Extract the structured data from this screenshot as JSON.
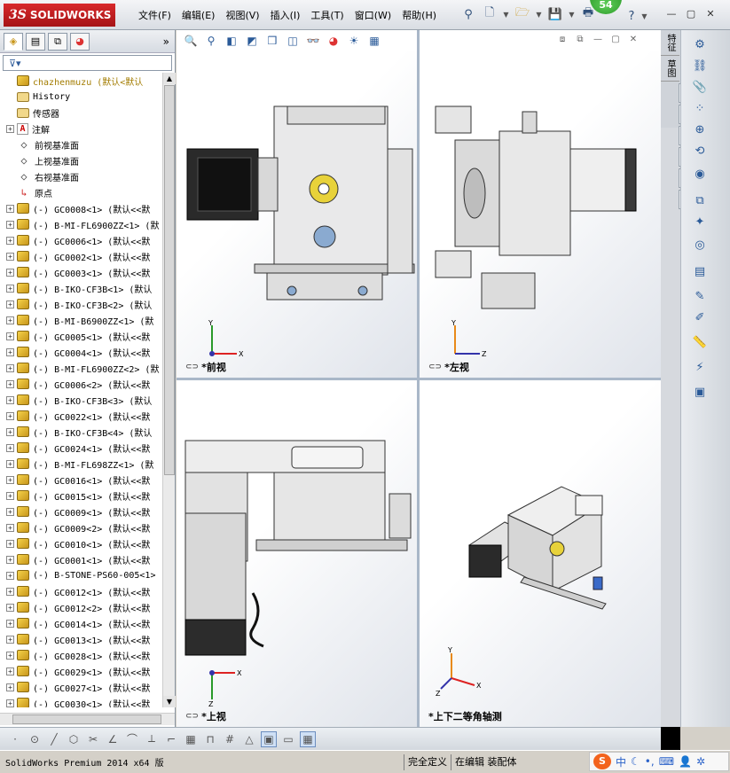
{
  "app": {
    "logo_text": "SOLIDWORKS",
    "logo_ds": "3S",
    "notification_count": "54"
  },
  "menu": [
    "文件(F)",
    "编辑(E)",
    "视图(V)",
    "插入(I)",
    "工具(T)",
    "窗口(W)",
    "帮助(H)"
  ],
  "feature_manager": {
    "filter_icon": "filter-icon",
    "root": "chazhenmuzu  (默认<默认",
    "items": [
      {
        "label": "History",
        "icon": "history",
        "expandable": false
      },
      {
        "label": "传感器",
        "icon": "sensor",
        "expandable": false
      },
      {
        "label": "注解",
        "icon": "annotation",
        "expandable": true
      },
      {
        "label": "前视基准面",
        "icon": "plane",
        "expandable": false
      },
      {
        "label": "上视基准面",
        "icon": "plane",
        "expandable": false
      },
      {
        "label": "右视基准面",
        "icon": "plane",
        "expandable": false
      },
      {
        "label": "原点",
        "icon": "origin",
        "expandable": false
      },
      {
        "label": "(-) GC0008<1> (默认<<默",
        "icon": "part",
        "expandable": true
      },
      {
        "label": "(-) B-MI-FL6900ZZ<1> (默",
        "icon": "part",
        "expandable": true
      },
      {
        "label": "(-) GC0006<1> (默认<<默",
        "icon": "part",
        "expandable": true
      },
      {
        "label": "(-) GC0002<1> (默认<<默",
        "icon": "part",
        "expandable": true
      },
      {
        "label": "(-) GC0003<1> (默认<<默",
        "icon": "part",
        "expandable": true
      },
      {
        "label": "(-) B-IKO-CF3B<1> (默认",
        "icon": "part",
        "expandable": true
      },
      {
        "label": "(-) B-IKO-CF3B<2> (默认",
        "icon": "part",
        "expandable": true
      },
      {
        "label": "(-) B-MI-B6900ZZ<1> (默",
        "icon": "part",
        "expandable": true
      },
      {
        "label": "(-) GC0005<1> (默认<<默",
        "icon": "part",
        "expandable": true
      },
      {
        "label": "(-) GC0004<1> (默认<<默",
        "icon": "part",
        "expandable": true
      },
      {
        "label": "(-) B-MI-FL6900ZZ<2> (默",
        "icon": "part",
        "expandable": true
      },
      {
        "label": "(-) GC0006<2> (默认<<默",
        "icon": "part",
        "expandable": true
      },
      {
        "label": "(-) B-IKO-CF3B<3> (默认",
        "icon": "part",
        "expandable": true
      },
      {
        "label": "(-) GC0022<1> (默认<<默",
        "icon": "part",
        "expandable": true
      },
      {
        "label": "(-) B-IKO-CF3B<4> (默认",
        "icon": "part",
        "expandable": true
      },
      {
        "label": "(-) GC0024<1> (默认<<默",
        "icon": "part",
        "expandable": true
      },
      {
        "label": "(-) B-MI-FL698ZZ<1> (默",
        "icon": "part",
        "expandable": true
      },
      {
        "label": "(-) GC0016<1> (默认<<默",
        "icon": "part",
        "expandable": true
      },
      {
        "label": "(-) GC0015<1> (默认<<默",
        "icon": "part",
        "expandable": true
      },
      {
        "label": "(-) GC0009<1> (默认<<默",
        "icon": "part",
        "expandable": true
      },
      {
        "label": "(-) GC0009<2> (默认<<默",
        "icon": "part",
        "expandable": true
      },
      {
        "label": "(-) GC0010<1> (默认<<默",
        "icon": "part",
        "expandable": true
      },
      {
        "label": "(-) GC0001<1> (默认<<默",
        "icon": "part",
        "expandable": true
      },
      {
        "label": "(-) B-STONE-PS60-005<1>",
        "icon": "part",
        "expandable": true
      },
      {
        "label": "(-) GC0012<1> (默认<<默",
        "icon": "part",
        "expandable": true
      },
      {
        "label": "(-) GC0012<2> (默认<<默",
        "icon": "part",
        "expandable": true
      },
      {
        "label": "(-) GC0014<1> (默认<<默",
        "icon": "part",
        "expandable": true
      },
      {
        "label": "(-) GC0013<1> (默认<<默",
        "icon": "part",
        "expandable": true
      },
      {
        "label": "(-) GC0028<1> (默认<<默",
        "icon": "part",
        "expandable": true
      },
      {
        "label": "(-) GC0029<1> (默认<<默",
        "icon": "part",
        "expandable": true
      },
      {
        "label": "(-) GC0027<1> (默认<<默",
        "icon": "part",
        "expandable": true
      },
      {
        "label": "(-) GC0030<1> (默认<<默",
        "icon": "part",
        "expandable": true
      }
    ]
  },
  "viewports": {
    "front": "*前视",
    "left": "*左视",
    "top": "*上视",
    "iso": "*上下二等角轴测"
  },
  "axes": {
    "x": "X",
    "y": "Y",
    "z": "Z"
  },
  "task_pane": {
    "tab1": "特征",
    "tab2": "草图"
  },
  "status": {
    "product": "SolidWorks Premium 2014 x64 版",
    "fully_defined": "完全定义",
    "editing": "在编辑 装配体"
  },
  "ime": {
    "logo": "S",
    "mode": "中"
  }
}
